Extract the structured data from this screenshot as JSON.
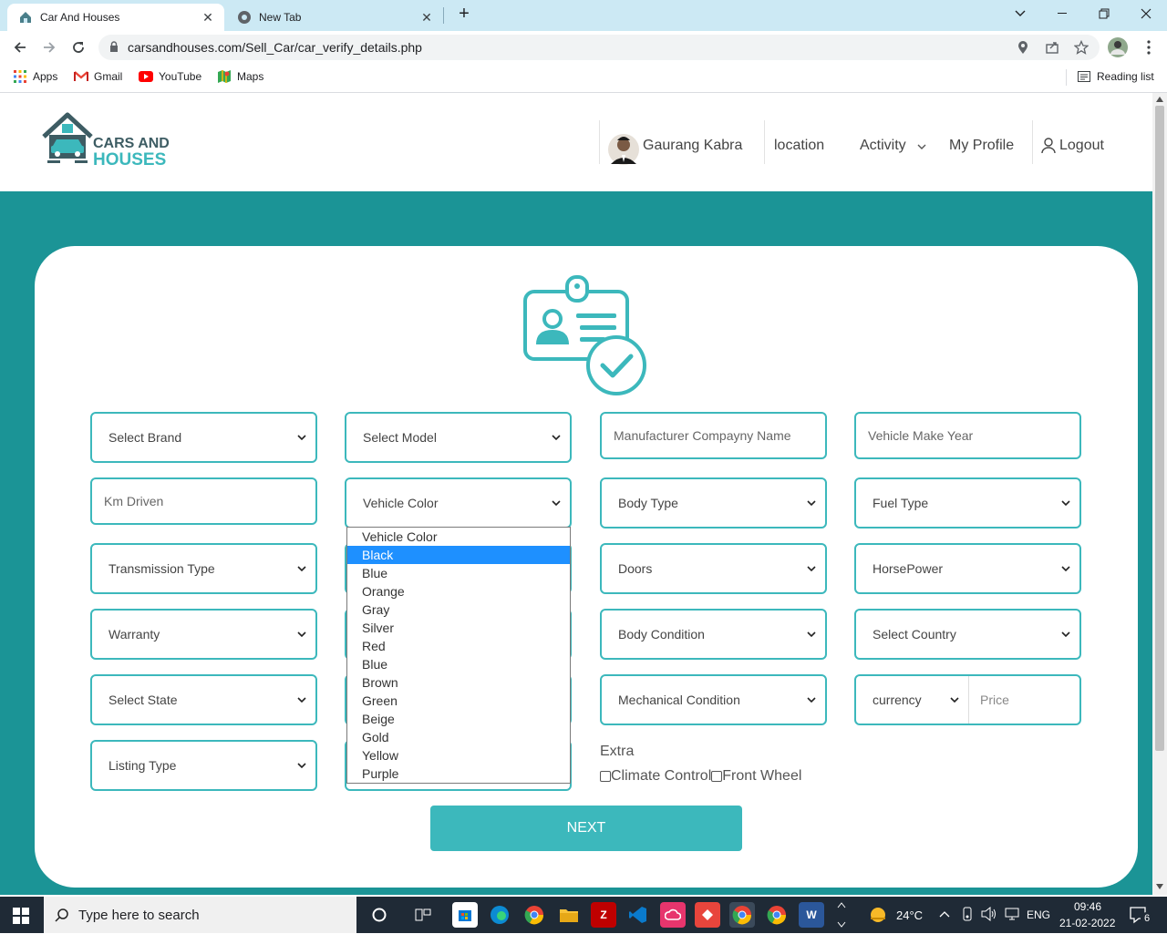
{
  "browser": {
    "tabs": [
      {
        "title": "Car And Houses",
        "close": "✕"
      },
      {
        "title": "New Tab",
        "close": "✕"
      }
    ],
    "new_tab": "+",
    "address": "carsandhouses.com/Sell_Car/car_verify_details.php",
    "bookmarks": [
      {
        "label": "Apps"
      },
      {
        "label": "Gmail"
      },
      {
        "label": "YouTube"
      },
      {
        "label": "Maps"
      }
    ],
    "reading_list": "Reading list"
  },
  "header": {
    "logo_top": "CARS AND",
    "logo_bottom": "HOUSES",
    "user_name": "Gaurang Kabra",
    "nav": {
      "location": "location",
      "activity": "Activity",
      "profile": "My Profile",
      "logout": "Logout"
    }
  },
  "form": {
    "select_brand": "Select Brand",
    "select_model": "Select Model",
    "manufacturer_placeholder": "Manufacturer Compayny Name",
    "make_year_placeholder": "Vehicle Make Year",
    "km_placeholder": "Km Driven",
    "vehicle_color": "Vehicle Color",
    "body_type": "Body Type",
    "fuel_type": "Fuel Type",
    "transmission": "Transmission Type",
    "doors": "Doors",
    "horsepower": "HorsePower",
    "warranty": "Warranty",
    "body_condition": "Body Condition",
    "select_country": "Select Country",
    "select_state": "Select State",
    "mechanical_condition": "Mechanical Condition",
    "currency": "currency",
    "price_placeholder": "Price",
    "listing_type": "Listing Type",
    "extra_label": "Extra",
    "extras": [
      {
        "label": "Climate Control",
        "checked": false
      },
      {
        "label": "Front Wheel",
        "checked": false
      }
    ],
    "next": "NEXT"
  },
  "color_dropdown": {
    "highlighted": "Black",
    "options": [
      "Vehicle Color",
      "Black",
      "Blue",
      "Orange",
      "Gray",
      "Silver",
      "Red",
      "Blue",
      "Brown",
      "Green",
      "Beige",
      "Gold",
      "Yellow",
      "Purple"
    ]
  },
  "taskbar": {
    "search_placeholder": "Type here to search",
    "weather": "24°C",
    "lang": "ENG",
    "time": "09:46",
    "date": "21-02-2022",
    "notifications": "6"
  },
  "colors": {
    "teal": "#1b9496",
    "accent": "#3cb8bc",
    "highlight": "#1e90ff"
  }
}
